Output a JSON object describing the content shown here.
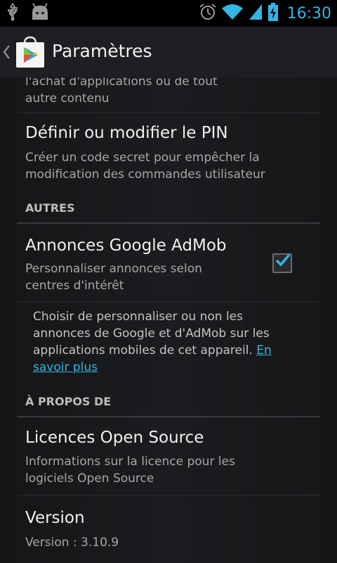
{
  "status_bar": {
    "time": "16:30",
    "icons": [
      "usb-icon",
      "android-icon",
      "alarm-icon",
      "wifi-icon",
      "signal-icon",
      "battery-charging-icon"
    ]
  },
  "action_bar": {
    "title": "Paramètres"
  },
  "settings": {
    "cut_off_sub_line1": "l'achat d'applications ou de tout",
    "cut_off_sub_line2": "autre contenu",
    "pin": {
      "title": "Définir ou modifier le PIN",
      "sub_line1": "Créer un code secret pour empêcher la",
      "sub_line2": "modification des commandes utilisateur"
    },
    "cat_other": "AUTRES",
    "admob": {
      "title": "Annonces Google AdMob",
      "sub_line1": "Personnaliser annonces selon",
      "sub_line2": "centres d'intérêt",
      "checked": true
    },
    "admob_info": {
      "line1": "Choisir de personnaliser ou non les",
      "line2": "annonces de Google et d'AdMob sur les",
      "line3": "applications mobiles de cet appareil.",
      "link_part1": "En",
      "link_part2": "savoir plus"
    },
    "cat_about": "À PROPOS DE",
    "licences": {
      "title": "Licences Open Source",
      "sub_line1": "Informations sur la licence pour les",
      "sub_line2": "logiciels Open Source"
    },
    "version": {
      "title": "Version",
      "sub": "Version : 3.10.9"
    }
  },
  "colors": {
    "accent": "#33b5e5",
    "background": "#151618",
    "action_bar": "#1d1f22"
  }
}
